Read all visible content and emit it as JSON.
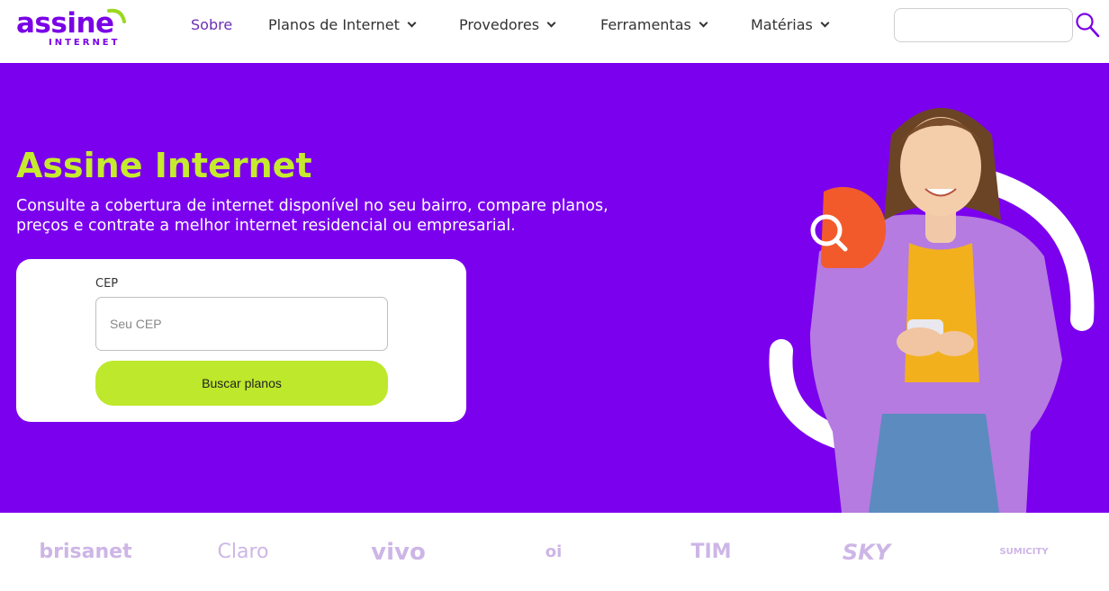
{
  "header": {
    "logo": {
      "main": "assine",
      "sub": "INTERNET"
    },
    "nav": [
      {
        "label": "Sobre",
        "dropdown": false,
        "active": true
      },
      {
        "label": "Planos de Internet",
        "dropdown": true
      },
      {
        "label": "Provedores",
        "dropdown": true
      },
      {
        "label": "Ferramentas",
        "dropdown": true
      },
      {
        "label": "Matérias",
        "dropdown": true
      }
    ],
    "search": {
      "placeholder": "",
      "icon": "search-icon"
    }
  },
  "hero": {
    "title": "Assine Internet",
    "subtitle": "Consulte a cobertura de internet disponível no seu bairro, compare planos, preços e contrate a melhor internet residencial ou empresarial.",
    "form": {
      "label": "CEP",
      "placeholder": "Seu CEP",
      "button": "Buscar planos"
    }
  },
  "brands": [
    "brisanet",
    "Claro",
    "vivo",
    "oi",
    "TIM",
    "SKY",
    "SUMICITY"
  ],
  "colors": {
    "brand_purple": "#7b00ee",
    "accent_lime": "#bde82b",
    "title_lime": "#c5ea2e",
    "brand_logos": "#cdb6e6",
    "search_bubble": "#f25a2b"
  }
}
